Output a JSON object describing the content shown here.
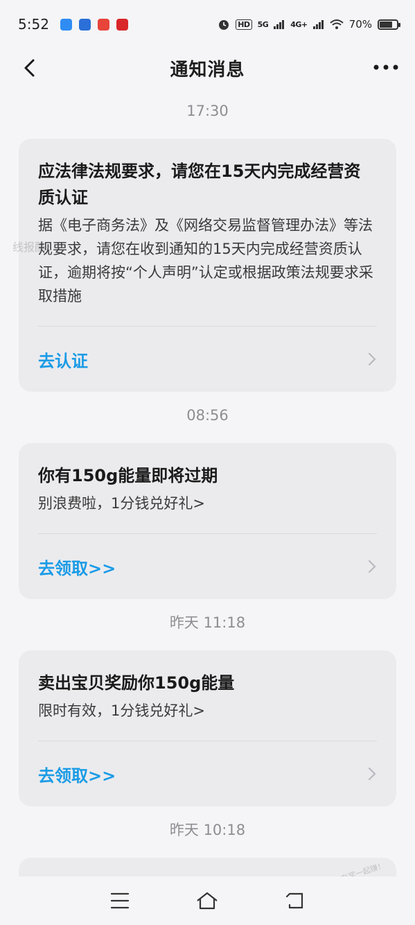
{
  "status_bar": {
    "time": "5:52",
    "network_hd": "HD",
    "network_5g": "5G",
    "network_4g": "4G+",
    "battery": "70%",
    "battery_level": 0.7
  },
  "nav": {
    "title": "通知消息"
  },
  "notifications": [
    {
      "time": "17:30",
      "title": "应法律法规要求，请您在15天内完成经营资质认证",
      "body": "据《电子商务法》及《网络交易监督管理办法》等法规要求，请您在收到通知的15天内完成经营资质认证，逾期将按“个人声明”认定或根据政策法规要求采取措施",
      "action": "去认证"
    },
    {
      "time": "08:56",
      "title": "你有150g能量即将过期",
      "body": "别浪费啦，1分钱兑好礼>",
      "action": "去领取>>"
    },
    {
      "time": "昨天 11:18",
      "title": "卖出宝贝奖励你150g能量",
      "body": "限时有效，1分钱兑好礼>",
      "action": "去领取>>"
    },
    {
      "time": "昨天 10:18"
    }
  ],
  "watermarks": {
    "left": "线报酷",
    "right": "赚客吧，有奖一起赚！"
  },
  "colors": {
    "accent": "#1a9be6",
    "card_bg": "#ebebee",
    "page_bg": "#f5f5f7"
  }
}
